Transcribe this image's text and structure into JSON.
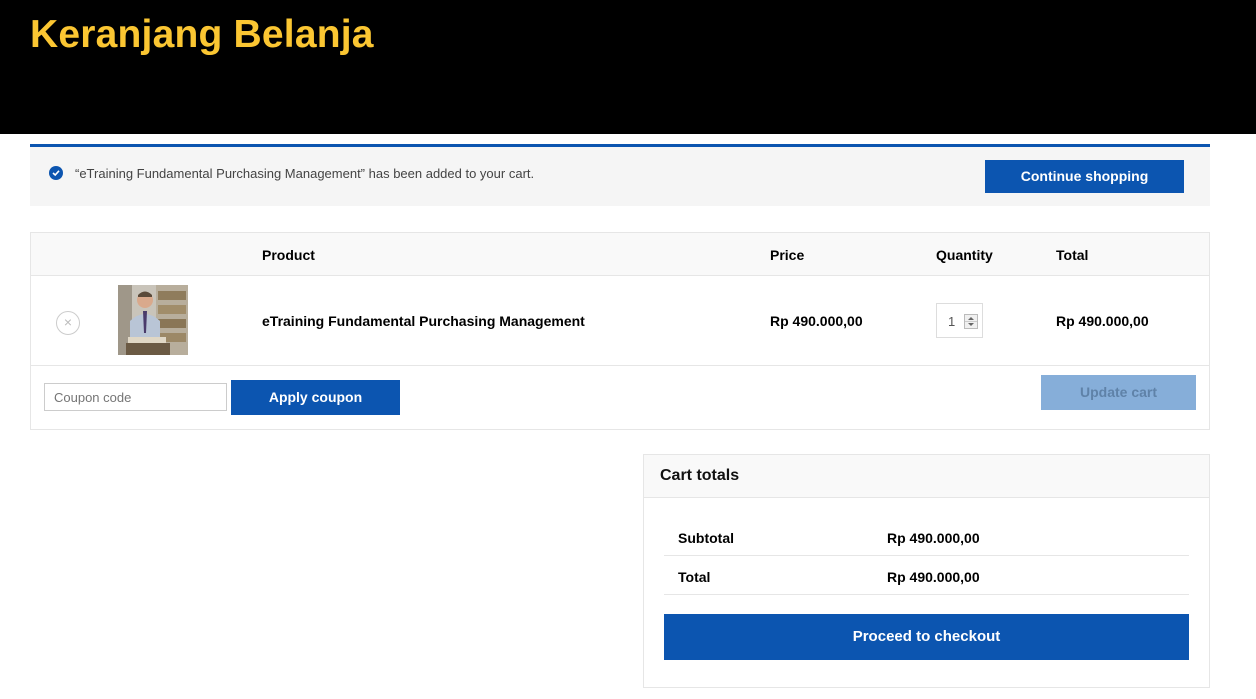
{
  "header": {
    "title": "Keranjang Belanja"
  },
  "notice": {
    "message": "“eTraining Fundamental Purchasing Management” has been added to your cart.",
    "continue_label": "Continue shopping"
  },
  "cart": {
    "columns": {
      "product": "Product",
      "price": "Price",
      "quantity": "Quantity",
      "total": "Total"
    },
    "items": [
      {
        "remove_symbol": "×",
        "name": "eTraining Fundamental Purchasing Management",
        "price": "Rp 490.000,00",
        "quantity": "1",
        "total": "Rp 490.000,00"
      }
    ],
    "coupon_placeholder": "Coupon code",
    "apply_coupon_label": "Apply coupon",
    "update_cart_label": "Update cart"
  },
  "totals": {
    "title": "Cart totals",
    "subtotal_label": "Subtotal",
    "subtotal_value": "Rp 490.000,00",
    "total_label": "Total",
    "total_value": "Rp 490.000,00",
    "checkout_label": "Proceed to checkout"
  },
  "colors": {
    "accent": "#0c55b0",
    "title": "#fbc632",
    "header_bg": "#000000"
  },
  "icons": {
    "notice": "check-circle-icon",
    "remove": "remove-icon",
    "thumbnail": "product-thumbnail"
  }
}
